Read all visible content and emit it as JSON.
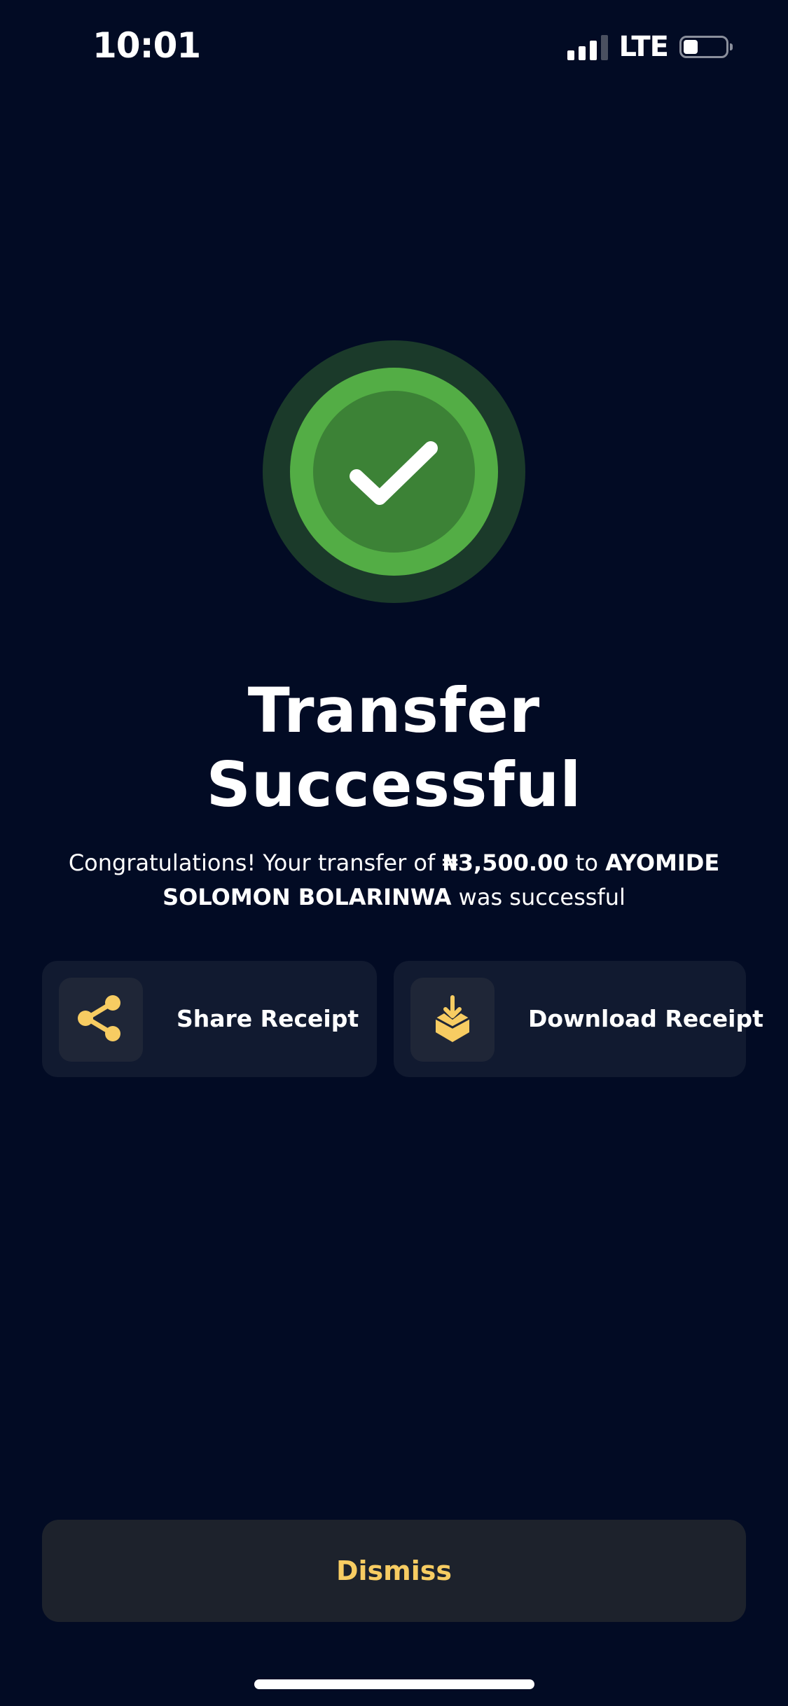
{
  "status_bar": {
    "time": "10:01",
    "network": "LTE"
  },
  "title": {
    "line1": "Transfer",
    "line2": "Successful"
  },
  "message": {
    "prefix": "Congratulations! Your transfer of",
    "amount": "₦3,500.00",
    "middle": "to",
    "recipient": "AYOMIDE SOLOMON BOLARINWA",
    "suffix": "was successful"
  },
  "actions": {
    "share_label": "Share Receipt",
    "download_label": "Download Receipt",
    "dismiss_label": "Dismiss"
  },
  "colors": {
    "background": "#020b24",
    "success_green": "#53ad45",
    "accent_yellow": "#f7cc62",
    "card": "#111a30"
  },
  "icons": {
    "success": "checkmark-icon",
    "share": "share-icon",
    "download": "download-box-icon"
  }
}
